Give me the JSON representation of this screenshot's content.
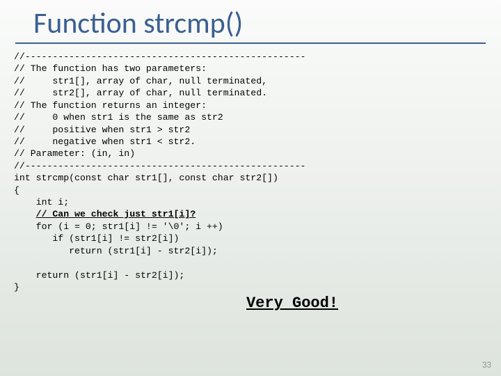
{
  "title": "Function strcmp()",
  "code_lines": [
    "//---------------------------------------------------",
    "// The function has two parameters:",
    "//     str1[], array of char, null terminated,",
    "//     str2[], array of char, null terminated.",
    "// The function returns an integer:",
    "//     0 when str1 is the same as str2",
    "//     positive when str1 > str2",
    "//     negative when str1 < str2.",
    "// Parameter: (in, in)",
    "//---------------------------------------------------",
    "int strcmp(const char str1[], const char str2[])",
    "{",
    "    int i;"
  ],
  "underline_line_prefix": "    ",
  "underline_line": "// Can we check just str1[i]?",
  "code_lines_after": [
    "    for (i = 0; str1[i] != '\\0'; i ++)",
    "       if (str1[i] != str2[i])",
    "          return (str1[i] - str2[i]);",
    "",
    "    return (str1[i] - str2[i]);",
    "}"
  ],
  "verygood": "Very Good!",
  "page_number": "33"
}
